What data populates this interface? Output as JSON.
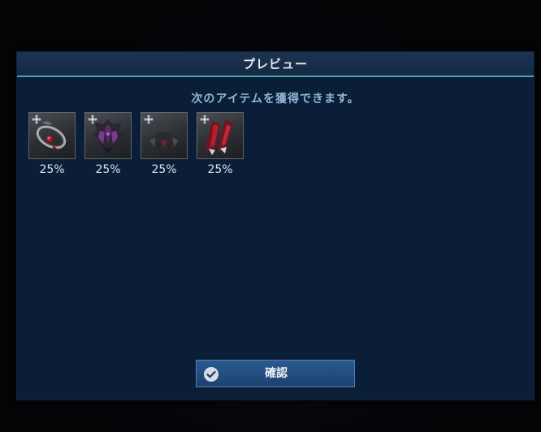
{
  "dialog": {
    "title": "プレビュー",
    "message": "次のアイテムを獲得できます。",
    "confirm_label": "確認"
  },
  "items": [
    {
      "icon": "ring-accessory-icon",
      "rate": "25%"
    },
    {
      "icon": "armor-icon",
      "rate": "25%"
    },
    {
      "icon": "helmet-icon",
      "rate": "25%"
    },
    {
      "icon": "gloves-icon",
      "rate": "25%"
    }
  ],
  "colors": {
    "panel": "#0b1e37",
    "header_line": "#4aa6b4",
    "message": "#8fb8d8",
    "button": "#1b4170"
  }
}
